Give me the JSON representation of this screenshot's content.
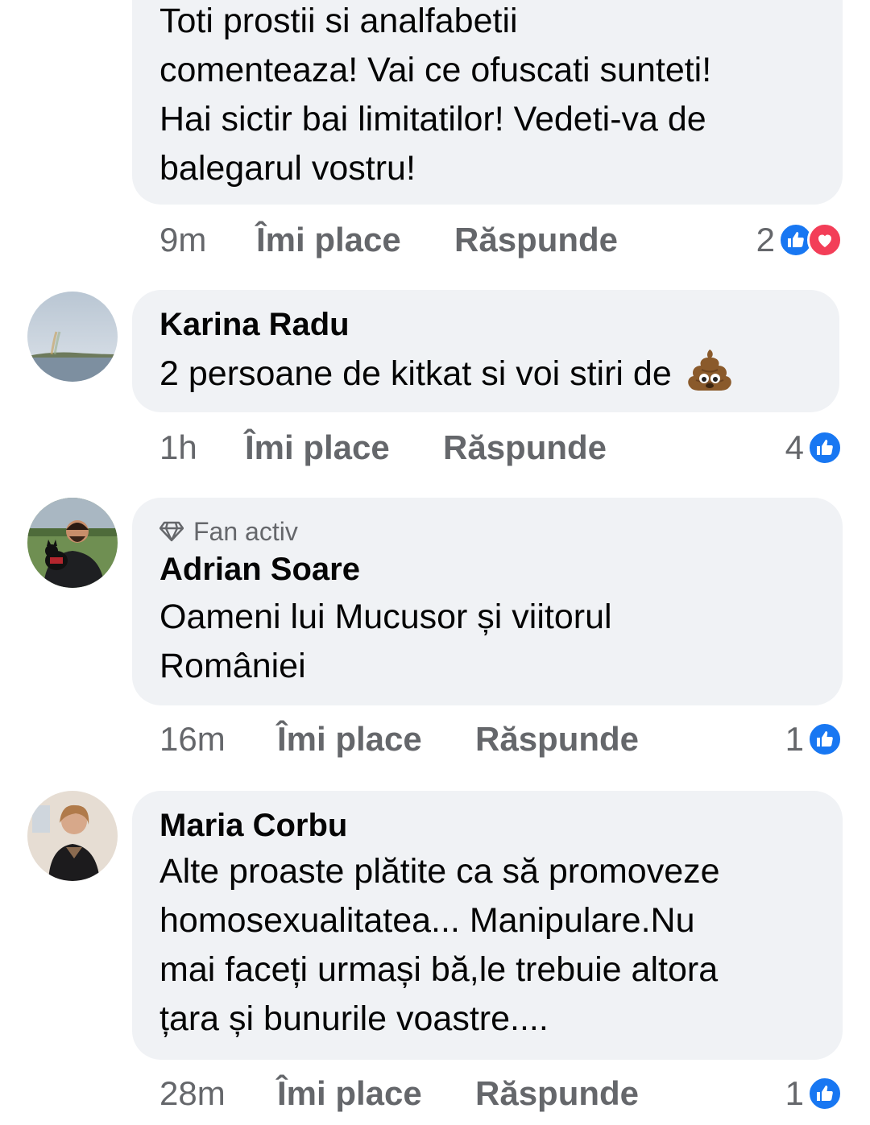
{
  "comments": [
    {
      "author": "",
      "badge": "",
      "text_lines": [
        "Toti prostii si analfabetii",
        "comenteaza! Vai ce ofuscati sunteti!",
        "Hai sictir bai limitatilor! Vedeti-va de",
        "balegarul vostru!"
      ],
      "time": "9m",
      "like_label": "Îmi place",
      "reply_label": "Răspunde",
      "reaction_count": "2",
      "reactions": [
        "like-icon",
        "love-icon"
      ]
    },
    {
      "author": "Karina Radu",
      "badge": "",
      "text_lines": [
        "2 persoane de kitkat si voi stiri de"
      ],
      "trailing_emoji": "pile-of-poo-emoji",
      "time": "1h",
      "like_label": "Îmi place",
      "reply_label": "Răspunde",
      "reaction_count": "4",
      "reactions": [
        "like-icon"
      ]
    },
    {
      "author": "Adrian Soare",
      "badge": "Fan activ",
      "badge_icon": "diamond-icon",
      "text_lines": [
        "Oameni lui Mucusor și viitorul",
        "României"
      ],
      "time": "16m",
      "like_label": "Îmi place",
      "reply_label": "Răspunde",
      "reaction_count": "1",
      "reactions": [
        "like-icon"
      ]
    },
    {
      "author": "Maria Corbu",
      "badge": "",
      "text_lines": [
        "Alte proaste plătite ca să promoveze",
        "homosexualitatea... Manipulare.Nu",
        "mai faceți urmași bă,le trebuie altora",
        "țara și bunurile voastre...."
      ],
      "time": "28m",
      "like_label": "Îmi place",
      "reply_label": "Răspunde",
      "reaction_count": "1",
      "reactions": [
        "like-icon"
      ]
    }
  ],
  "colors": {
    "bubble_bg": "#f0f2f5",
    "meta_text": "#65676b",
    "like_blue": "#1877f2",
    "love_red": "#f33e58"
  }
}
